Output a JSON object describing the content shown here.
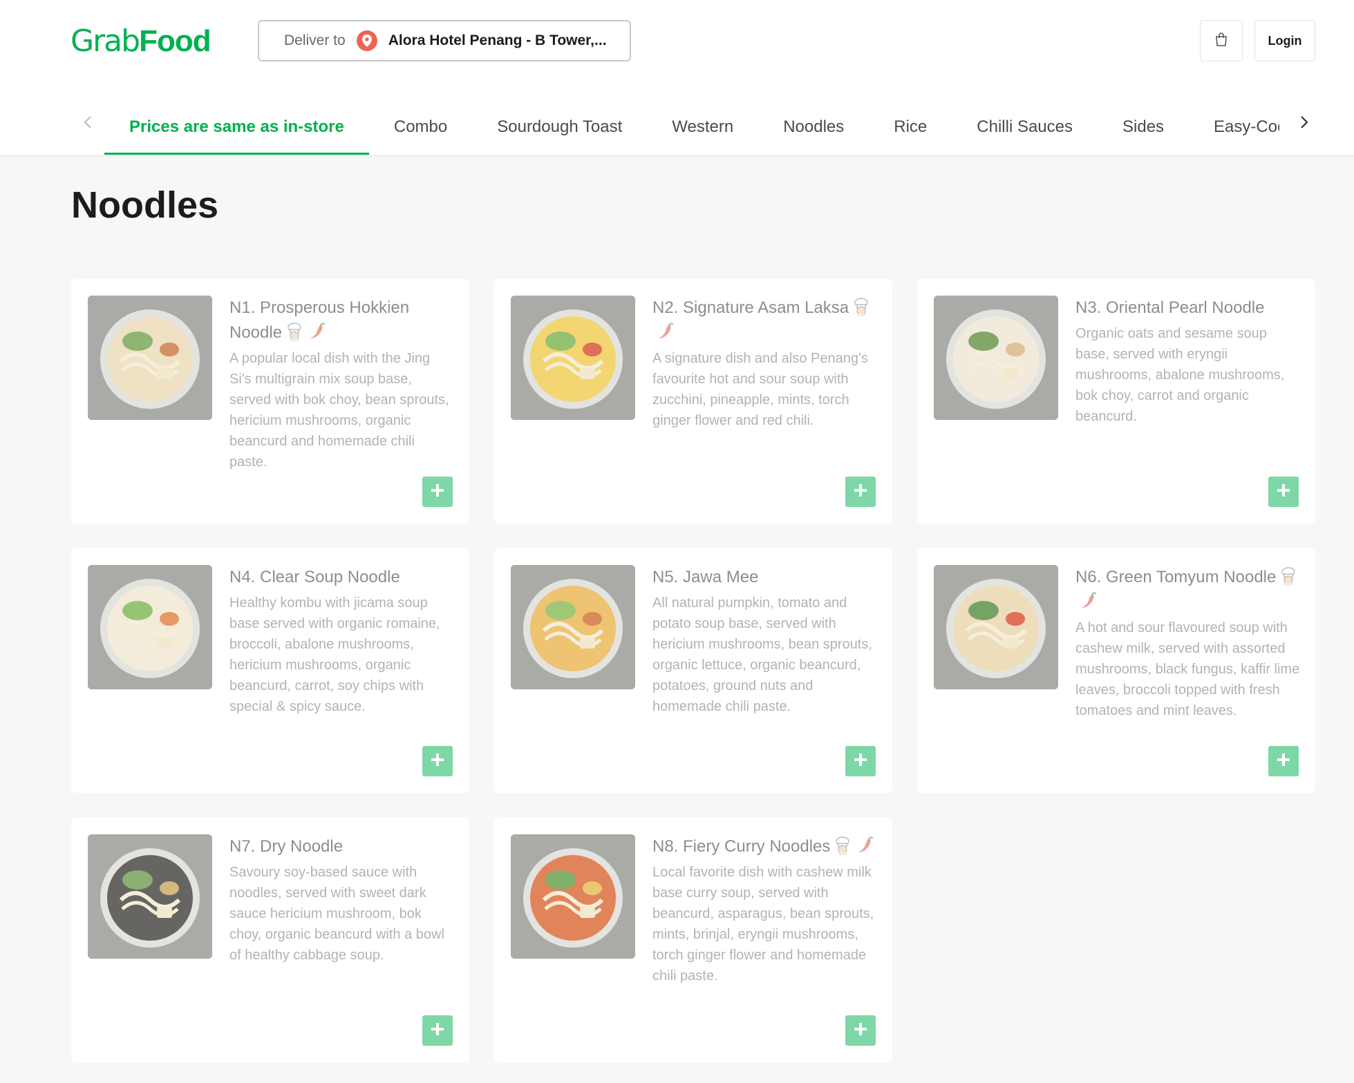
{
  "header": {
    "logo_grab": "Grab",
    "logo_food": "Food",
    "deliver_label": "Deliver to",
    "address": "Alora Hotel Penang - B Tower,...",
    "cart_icon": "shopping-bag-icon",
    "login_label": "Login"
  },
  "tabs": [
    {
      "label": "Prices are same as in-store",
      "active": true
    },
    {
      "label": "Combo"
    },
    {
      "label": "Sourdough Toast"
    },
    {
      "label": "Western"
    },
    {
      "label": "Noodles"
    },
    {
      "label": "Rice"
    },
    {
      "label": "Chilli Sauces"
    },
    {
      "label": "Sides"
    },
    {
      "label": "Easy-Coo"
    }
  ],
  "section": {
    "title": "Noodles"
  },
  "items": [
    {
      "name": "N1. Prosperous Hokkien Noodle",
      "badges": [
        "chef-icon",
        "chili-icon"
      ],
      "desc": "A popular local dish with the Jing Si's multigrain mix soup base, served with bok choy, bean sprouts, hericium mushrooms, organic beancurd and homemade chili paste."
    },
    {
      "name": "N2. Signature Asam Laksa",
      "badges": [
        "chef-icon",
        "chili-icon"
      ],
      "desc": "A signature dish and also Penang's favourite hot and sour soup with zucchini, pineapple, mints, torch ginger flower and red chili."
    },
    {
      "name": "N3. Oriental Pearl Noodle",
      "badges": [],
      "desc": "Organic oats and sesame soup base, served with eryngii mushrooms, abalone mushrooms, bok choy, carrot and organic beancurd."
    },
    {
      "name": "N4. Clear Soup Noodle",
      "badges": [],
      "desc": "Healthy kombu with jicama soup base served with organic romaine, broccoli, abalone mushrooms, hericium mushrooms, organic beancurd, carrot, soy chips with special & spicy sauce."
    },
    {
      "name": "N5. Jawa Mee",
      "badges": [],
      "desc": "All natural pumpkin, tomato and potato soup base, served with hericium mushrooms, bean sprouts, organic lettuce, organic beancurd, potatoes, ground nuts and homemade chili paste."
    },
    {
      "name": "N6. Green Tomyum Noodle",
      "badges": [
        "chef-icon",
        "chili-icon"
      ],
      "desc": "A hot and sour flavoured soup with cashew milk, served with assorted mushrooms, black fungus, kaffir lime leaves, broccoli topped with fresh tomatoes and mint leaves."
    },
    {
      "name": "N7. Dry Noodle",
      "badges": [],
      "desc": "Savoury soy-based sauce with noodles, served with sweet dark sauce hericium mushroom, bok choy, organic beancurd with a bowl of healthy cabbage soup."
    },
    {
      "name": "N8. Fiery Curry Noodles",
      "badges": [
        "chef-icon",
        "chili-icon"
      ],
      "desc": "Local favorite dish with cashew milk base curry soup, served with beancurd, asparagus, bean sprouts, mints, brinjal, eryngii mushrooms, torch ginger flower and homemade chili paste."
    }
  ],
  "colors": {
    "brand": "#00b14f",
    "pin": "#ee6352",
    "chili": "#d9472b"
  }
}
